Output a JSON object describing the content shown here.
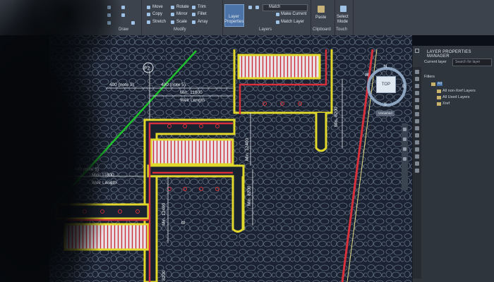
{
  "ribbon": {
    "modify_tools": {
      "move": "Move",
      "rotate": "Rotate",
      "trim": "Trim",
      "copy": "Copy",
      "mirror": "Mirror",
      "fillet": "Fillet",
      "stretch": "Stretch",
      "scale": "Scale",
      "array": "Array"
    },
    "layer_properties": {
      "line1": "Layer",
      "line2": "Properties"
    },
    "match_field": "Match",
    "make_current": "Make Current",
    "match_layer": "Match Layer",
    "paste": "Paste",
    "select_mode": {
      "line1": "Select",
      "line2": "Mode"
    },
    "panels": {
      "draw": "Draw",
      "modify": "Modify",
      "layers": "Layers",
      "clipboard": "Clipboard",
      "touch": "Touch"
    }
  },
  "layer_manager": {
    "title": "LAYER PROPERTIES MANAGER",
    "current_layer_label": "Current layer",
    "search_placeholder": "Search for layer",
    "filters_label": "Filters",
    "tree": [
      "All",
      "All non-Xref Layers",
      "All Used Layers",
      "Xref"
    ]
  },
  "viewcube": {
    "top_label": "TOP",
    "north": "N",
    "south": "S",
    "east": "E",
    "west": "W",
    "ucs_label": "Unnamed"
  },
  "drawing": {
    "point_marker": "P2",
    "dims": {
      "note_left": "400 (note 5)",
      "note_right": "400 (note 5)",
      "min_11800": "Min. 11800",
      "weir_length": "Weir Length",
      "min_11800_b": "Min. 11800",
      "weir_length_b": "Weir Length",
      "note_lower": "400 (note 5)",
      "min_12400": "Min. 12400",
      "min_8200_a": "Min. 8200",
      "min_8200_b": "Min. 8200",
      "min_12400_b": "Min. 12400",
      "value_8200": "8200",
      "section_mark": "B"
    }
  }
}
